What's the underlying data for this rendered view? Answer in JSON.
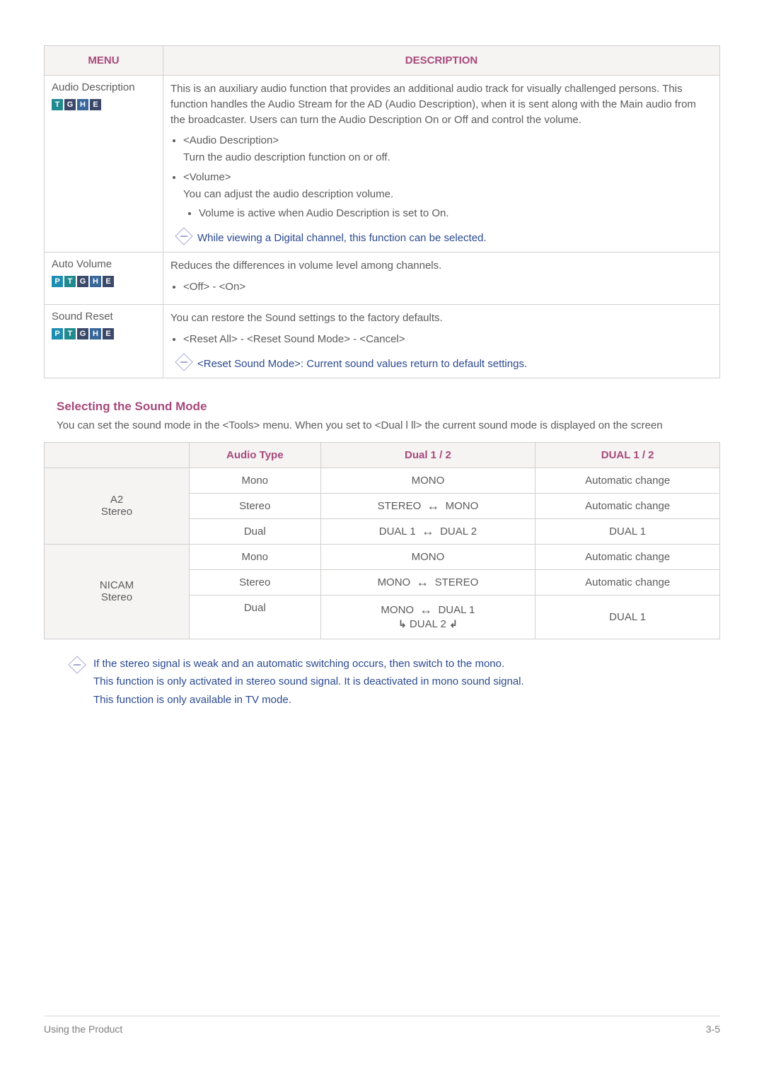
{
  "table1": {
    "headers": {
      "menu": "MENU",
      "description": "DESCRIPTION"
    },
    "rows": [
      {
        "menu": "Audio Description",
        "tags": [
          "T",
          "G",
          "H",
          "E"
        ],
        "intro": "This is an auxiliary audio function that provides an additional audio track for visually challenged persons. This function handles the Audio Stream for the AD (Audio Description), when it is sent along with the Main audio from the broadcaster. Users can turn the Audio Description On or Off and control the volume.",
        "bullets": [
          {
            "label": "<Audio Description>",
            "text": "Turn the audio description function on or off."
          },
          {
            "label": "<Volume>",
            "text": "You can adjust the audio description volume.",
            "sub": [
              "Volume is active when Audio Description is set to On."
            ]
          }
        ],
        "note": "While viewing a Digital channel, this function can be selected."
      },
      {
        "menu": "Auto Volume",
        "tags": [
          "P",
          "T",
          "G",
          "H",
          "E"
        ],
        "intro": "Reduces the differences in volume level among channels.",
        "bullets": [
          {
            "label": "<Off> - <On>"
          }
        ]
      },
      {
        "menu": "Sound Reset",
        "tags": [
          "P",
          "T",
          "G",
          "H",
          "E"
        ],
        "intro": "You can restore the Sound settings to the factory defaults.",
        "bullets": [
          {
            "label": "<Reset All> - <Reset Sound Mode> - <Cancel>"
          }
        ],
        "note": "<Reset Sound Mode>: Current sound values return to default settings."
      }
    ]
  },
  "section": {
    "title": "Selecting the Sound Mode",
    "intro": "You can set the sound mode in the <Tools> menu. When you set to <Dual l ll> the current sound mode is displayed on the screen"
  },
  "table2": {
    "headers": [
      "",
      "Audio Type",
      "Dual 1 / 2",
      "DUAL 1 / 2"
    ],
    "groups": [
      {
        "stub": "A2\nStereo",
        "rows": [
          {
            "type": "Mono",
            "dual12": [
              [
                "MONO"
              ]
            ],
            "dual": "Automatic change"
          },
          {
            "type": "Stereo",
            "dual12": [
              [
                "STEREO",
                "arrow",
                "MONO"
              ]
            ],
            "dual": "Automatic change"
          },
          {
            "type": "Dual",
            "dual12": [
              [
                "DUAL 1",
                "arrow",
                "DUAL 2"
              ]
            ],
            "dual": "DUAL 1"
          }
        ]
      },
      {
        "stub": "NICAM\nStereo",
        "rows": [
          {
            "type": "Mono",
            "dual12": [
              [
                "MONO"
              ]
            ],
            "dual": "Automatic change"
          },
          {
            "type": "Stereo",
            "dual12": [
              [
                "MONO",
                "arrow",
                "STEREO"
              ]
            ],
            "dual": "Automatic change"
          },
          {
            "type": "Dual",
            "dual12": [
              [
                "MONO",
                "arrow",
                "DUAL 1"
              ],
              [
                "l-elbow",
                "DUAL 2",
                "r-elbow"
              ]
            ],
            "dual": "DUAL 1"
          }
        ]
      }
    ]
  },
  "footnotes": [
    "If the stereo signal is weak and an automatic switching occurs, then switch to the mono.",
    "This function is only activated in stereo sound signal. It is deactivated in mono sound signal.",
    "This function is only available in TV mode."
  ],
  "footer": {
    "left": "Using the Product",
    "right": "3-5"
  },
  "arrow_char": "↔"
}
